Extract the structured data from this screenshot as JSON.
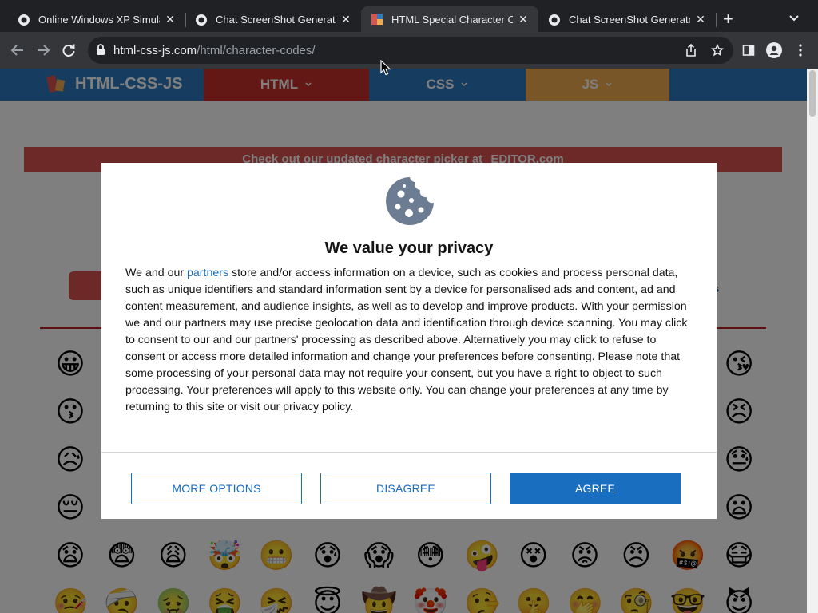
{
  "browser": {
    "tabs": [
      {
        "title": "Online Windows XP Simulat"
      },
      {
        "title": "Chat ScreenShot Generato"
      },
      {
        "title": "HTML Special Character Co"
      },
      {
        "title": "Chat ScreenShot Generato"
      }
    ],
    "active_tab_index": 2,
    "new_tab_symbol": "+",
    "close_symbol": "✕",
    "url_host": "html-css-js.com",
    "url_path": "/html/character-codes/"
  },
  "site": {
    "logo_text": "HTML-CSS-JS",
    "nav": [
      {
        "label": "HTML",
        "color": "#c9302c"
      },
      {
        "label": "CSS",
        "color": "#2d7bbf"
      },
      {
        "label": "JS",
        "color": "#f0ad4e"
      }
    ],
    "banner_text": "Check out our updated character picker at",
    "banner_link_text": "EDITOR.com",
    "category_partial": "cts",
    "emojis": [
      [
        "😀",
        "",
        "",
        "",
        "",
        "",
        "",
        "",
        "",
        "",
        "",
        "",
        "",
        "😘"
      ],
      [
        "😗",
        "",
        "",
        "",
        "",
        "",
        "",
        "",
        "",
        "",
        "",
        "",
        "",
        "😣"
      ],
      [
        "😥",
        "",
        "",
        "",
        "",
        "",
        "",
        "",
        "",
        "",
        "",
        "",
        "",
        "😓"
      ],
      [
        "😔",
        "",
        "",
        "",
        "",
        "",
        "",
        "",
        "",
        "",
        "",
        "",
        "",
        "😦"
      ],
      [
        "😧",
        "😨",
        "😩",
        "🤯",
        "😬",
        "😰",
        "😱",
        "😳",
        "🤪",
        "😵",
        "😡",
        "😠",
        "🤬",
        "😷"
      ],
      [
        "🤒",
        "🤕",
        "🤢",
        "🤮",
        "🤧",
        "😇",
        "🤠",
        "🤡",
        "🤥",
        "🤫",
        "🤭",
        "🧐",
        "🤓",
        "😈"
      ]
    ]
  },
  "consent": {
    "title": "We value your privacy",
    "intro_before_link": "We and our ",
    "partners_link": "partners",
    "intro_after_link": " store and/or access information on a device, such as cookies and process personal data, such as unique identifiers and standard information sent by a device for personalised ads and content, ad and content measurement, and audience insights, as well as to develop and improve products. With your permission we and our partners may use precise geolocation data and identification through device scanning. You may click to consent to our and our partners' processing as described above. Alternatively you may click to refuse to consent or access more detailed information and change your preferences before consenting. Please note that some processing of your personal data may not require your consent, but you have a right to object to such processing. Your preferences will apply to this website only. You can change your preferences at any time by returning to this site or visit our privacy policy.",
    "more_options_label": "MORE OPTIONS",
    "disagree_label": "DISAGREE",
    "agree_label": "AGREE",
    "accent_color": "#1a6ec0"
  }
}
